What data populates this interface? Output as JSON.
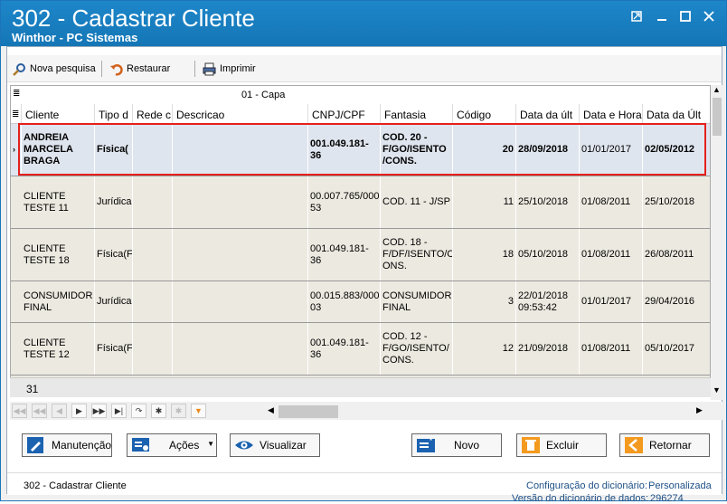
{
  "window": {
    "title": "302 - Cadastrar Cliente",
    "subtitle": "Winthor - PC Sistemas"
  },
  "toolbar": {
    "nova_pesquisa": "Nova pesquisa",
    "restaurar": "Restaurar",
    "imprimir": "Imprimir"
  },
  "grid": {
    "band_title": "01 - Capa",
    "columns": [
      "Cliente",
      "Tipo d",
      "Rede c",
      "Descricao",
      "CNPJ/CPF",
      "Fantasia",
      "Código",
      "Data da últ",
      "Data e Hora",
      "Data da Últ"
    ],
    "rows": [
      {
        "cliente": "ANDREIA MARCELA BRAGA",
        "tipo": "Física(",
        "rede": "",
        "descricao": "",
        "cnpj": "001.049.181-36",
        "fantasia": "COD. 20 - F/GO/ISENTO /CONS.",
        "codigo": "20",
        "data1": "28/09/2018",
        "data2": "01/01/2017",
        "data3": "02/05/2012"
      },
      {
        "cliente": "CLIENTE TESTE 11",
        "tipo": "Jurídica",
        "rede": "",
        "descricao": "",
        "cnpj": "00.007.765/0001-53",
        "fantasia": "COD. 11 - J/SP",
        "codigo": "11",
        "data1": "25/10/2018",
        "data2": "01/08/2011",
        "data3": "25/10/2018"
      },
      {
        "cliente": "CLIENTE TESTE 18",
        "tipo": "Física(F",
        "rede": "",
        "descricao": "",
        "cnpj": "001.049.181-36",
        "fantasia": "COD. 18 - F/DF/ISENTO/C ONS.",
        "codigo": "18",
        "data1": "05/10/2018",
        "data2": "01/08/2011",
        "data3": "26/08/2011"
      },
      {
        "cliente": "CONSUMIDOR FINAL",
        "tipo": "Jurídica",
        "rede": "",
        "descricao": "",
        "cnpj": "00.015.883/0001-03",
        "fantasia": "CONSUMIDOR FINAL",
        "codigo": "3",
        "data1": "22/01/2018 09:53:42",
        "data2": "01/01/2017",
        "data3": "29/04/2016"
      },
      {
        "cliente": "CLIENTE TESTE 12",
        "tipo": "Física(F",
        "rede": "",
        "descricao": "",
        "cnpj": "001.049.181-36",
        "fantasia": "COD. 12 - F/GO/ISENTO/ CONS.",
        "codigo": "12",
        "data1": "21/09/2018",
        "data2": "01/08/2011",
        "data3": "05/10/2017"
      }
    ],
    "count": "31"
  },
  "buttons": {
    "manutencao": "Manutenção",
    "acoes": "Ações",
    "visualizar": "Visualizar",
    "novo": "Novo",
    "excluir": "Excluir",
    "retornar": "Retornar"
  },
  "status": {
    "left": "302 - Cadastrar Cliente",
    "config_label": "Configuração do dicionário:",
    "config_value": "Personalizada",
    "versao_label": "Versão do dicionário de dados:",
    "versao_value": "296274"
  }
}
